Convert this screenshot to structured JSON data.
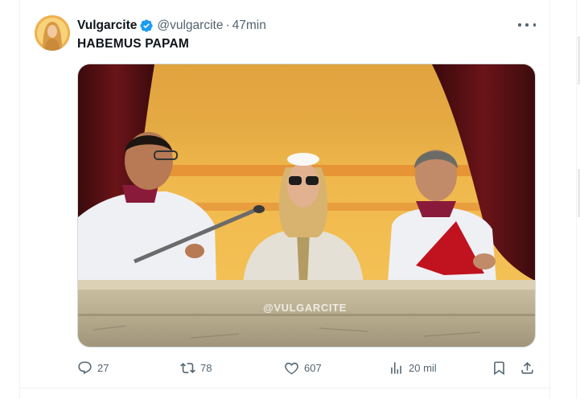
{
  "tweet": {
    "display_name": "Vulgarcite",
    "handle": "@vulgarcite",
    "separator": "·",
    "time": "47min",
    "text": "HABEMUS PAPAM",
    "media": {
      "watermark": "@VULGARCITE"
    },
    "stats": {
      "replies": "27",
      "retweets": "78",
      "likes": "607",
      "views": "20 mil"
    }
  },
  "colors": {
    "verified": "#1d9bf0",
    "secondary_text": "#536471",
    "primary_text": "#0f1419"
  }
}
